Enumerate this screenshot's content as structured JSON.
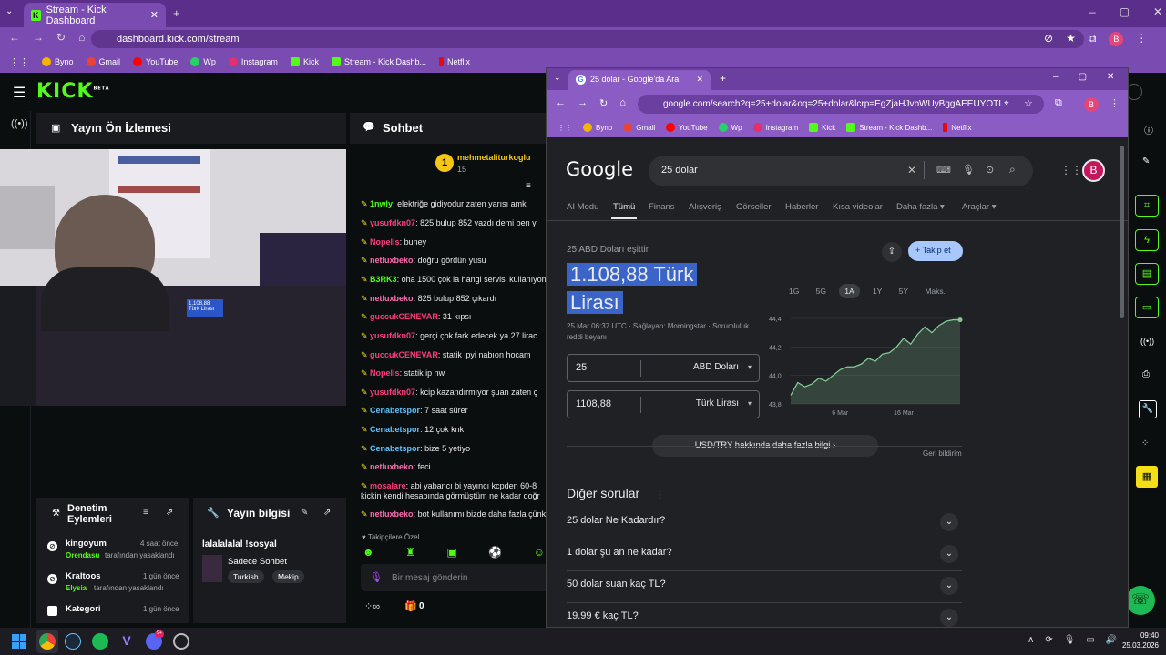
{
  "back_browser": {
    "tab_title": "Stream - Kick Dashboard",
    "url": "dashboard.kick.com/stream",
    "bookmarks": [
      "Byno",
      "Gmail",
      "YouTube",
      "Wp",
      "Instagram",
      "Kick",
      "Stream - Kick Dashb...",
      "Netflix"
    ]
  },
  "kick": {
    "logo": "KICK",
    "logo_beta": "BETA",
    "preview_title": "Yayın Ön İzlemesi",
    "chat_title": "Sohbet",
    "top_user": {
      "name": "mehmetaliturkoglu",
      "count": "15"
    },
    "chat": [
      {
        "user": "1nwly",
        "color": "#53fc18",
        "text": ": elektriğe gidiyodur zaten yarısı amk"
      },
      {
        "user": "yusufdkn07",
        "color": "#ff3b7f",
        "text": ": 825 bulup 852 yazdı demi ben y"
      },
      {
        "user": "Nopelis",
        "color": "#ff3b7f",
        "text": ": buney"
      },
      {
        "user": "netluxbeko",
        "color": "#ff6bb5",
        "text": ": doğru gördün yusu"
      },
      {
        "user": "B3RK3",
        "color": "#53fc18",
        "text": ": oha 1500 çok la hangi servisi kullanıyon"
      },
      {
        "user": "netluxbeko",
        "color": "#ff6bb5",
        "text": ": 825 bulup 852 çıkardı"
      },
      {
        "user": "guccukCENEVAR",
        "color": "#ff3b7f",
        "text": ": 31 kıpsı"
      },
      {
        "user": "yusufdkn07",
        "color": "#ff3b7f",
        "text": ": gerçi çok fark edecek ya 27 lirac"
      },
      {
        "user": "guccukCENEVAR",
        "color": "#ff3b7f",
        "text": ": statik ipyi nabıon hocam"
      },
      {
        "user": "Nopelis",
        "color": "#ff3b7f",
        "text": ": statik ip nw"
      },
      {
        "user": "yusufdkn07",
        "color": "#ff3b7f",
        "text": ": kcip kazandırmıyor şuan zaten ç"
      },
      {
        "user": "Cenabetspor",
        "color": "#5fc3ff",
        "text": ": 7 saat sürer"
      },
      {
        "user": "Cenabetspor",
        "color": "#5fc3ff",
        "text": ": 12 çok knk"
      },
      {
        "user": "Cenabetspor",
        "color": "#5fc3ff",
        "text": ": bize 5 yetiyo"
      },
      {
        "user": "netluxbeko",
        "color": "#ff6bb5",
        "text": ": feci"
      },
      {
        "user": "mosalare",
        "color": "#ff3b7f",
        "text": ": abi yabancı bi yayıncı kcpden 60-8"
      },
      {
        "user": "",
        "color": "#e8e8e8",
        "text": "kickin kendi hesabında görmüştüm ne kadar doğr"
      },
      {
        "user": "netluxbeko",
        "color": "#ff6bb5",
        "text": ": bot kullanımı bizde daha fazla çünkü"
      }
    ],
    "followers_only": "Takipçilere Özel",
    "chat_placeholder": "Bir mesaj gönderin",
    "chat_count": "0",
    "mod_title": "Denetim Eylemleri",
    "mod_items": [
      {
        "user": "kingoyum",
        "by": "Orendasu",
        "action": "tarafından yasaklandı",
        "time": "4 saat önce"
      },
      {
        "user": "Kraltoos",
        "by": "Elysia",
        "action": "tarafından yasaklandı",
        "time": "1 gün önce"
      },
      {
        "user": "Kategori",
        "by": "",
        "action": "",
        "time": "1 gün önce"
      }
    ],
    "stream_info_title": "Yayın bilgisi",
    "stream_title": "lalalalalal !sosyal",
    "category": "Sadece Sohbet",
    "tags": [
      "Turkish",
      "Mekip"
    ]
  },
  "front_browser": {
    "tab_title": "25 dolar - Google'da Ara",
    "url": "google.com/search?q=25+dolar&oq=25+dolar&lcrp=EgZjaHJvbWUyBggAEEUYOTI...",
    "bookmarks": [
      "Byno",
      "Gmail",
      "YouTube",
      "Wp",
      "Instagram",
      "Kick",
      "Stream - Kick Dashb...",
      "Netflix"
    ],
    "google_logo": "Google",
    "query": "25 dolar",
    "tabs": [
      "AI Modu",
      "Tümü",
      "Finans",
      "Alışveriş",
      "Görseller",
      "Haberler",
      "Kısa videolar",
      "Daha fazla",
      "Araçlar"
    ],
    "result_sub": "25 ABD Doları eşittir",
    "result_value": "1.108,88 Türk Lirası",
    "result_line1": "1.108,88 Türk",
    "result_line2": "Lirası",
    "meta": "25 Mar 06:37 UTC · Sağlayan: Morningstar · Sorumluluk reddi beyanı",
    "follow_label": "Takip et",
    "amount_from": "25",
    "currency_from": "ABD Doları",
    "amount_to": "1108,88",
    "currency_to": "Türk Lirası",
    "more_info": "USD/TRY hakkında daha fazla bilgi",
    "feedback": "Geri bildirim",
    "ranges": [
      "1G",
      "5G",
      "1A",
      "1Y",
      "5Y",
      "Maks."
    ],
    "active_range": "1A",
    "other_q_title": "Diğer sorular",
    "questions": [
      "25 dolar Ne Kadardır?",
      "1 dolar şu an ne kadar?",
      "50 dolar suan kaç TL?",
      "19.99 € kaç TL?"
    ],
    "profile_letter": "B"
  },
  "chart_data": {
    "type": "area",
    "x_tick_labels": [
      "6 Mar",
      "16 Mar"
    ],
    "y_tick_labels": [
      "44,4",
      "44,2",
      "44,0",
      "43,8"
    ],
    "ylim": [
      43.8,
      44.4
    ],
    "values": [
      43.86,
      43.95,
      43.92,
      43.94,
      43.98,
      43.96,
      44.0,
      44.04,
      44.06,
      44.06,
      44.08,
      44.12,
      44.1,
      44.15,
      44.16,
      44.2,
      44.26,
      44.22,
      44.29,
      44.34,
      44.3,
      44.35,
      44.38,
      44.39,
      44.39
    ]
  },
  "taskbar": {
    "time": "09:40",
    "date": "25.03.2026"
  }
}
